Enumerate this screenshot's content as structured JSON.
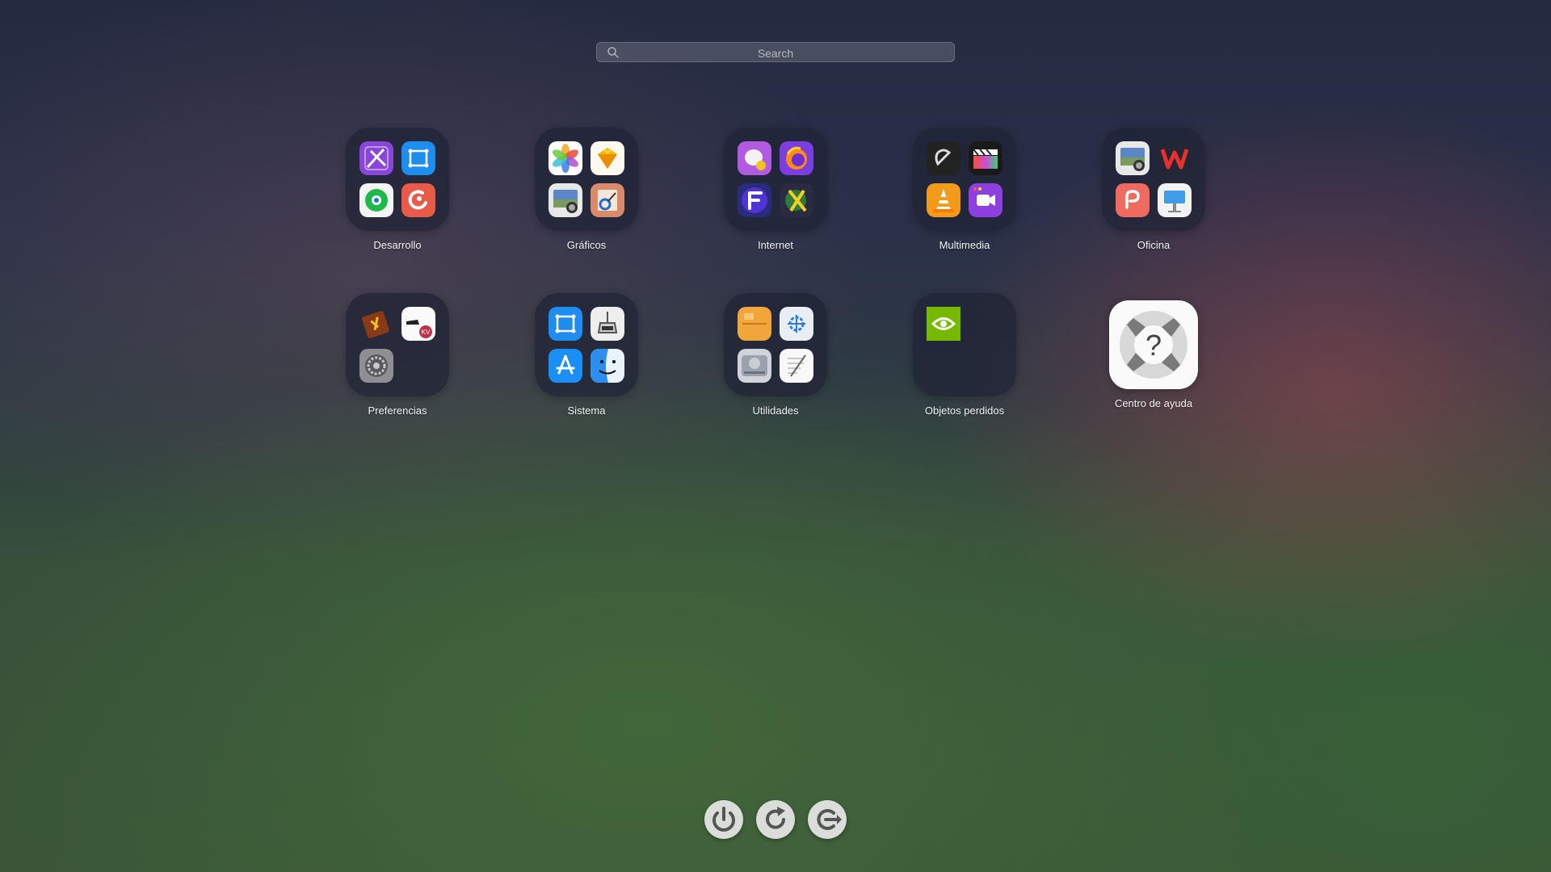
{
  "search": {
    "placeholder": "Search"
  },
  "folders": [
    {
      "label": "Desarrollo",
      "apps": [
        "xcode-tools-icon",
        "panel-app-icon",
        "green-circle-app-icon",
        "red-swirl-app-icon"
      ]
    },
    {
      "label": "Gráficos",
      "apps": [
        "photos-icon",
        "sketch-icon",
        "screenshot-icon",
        "preview-icon"
      ]
    },
    {
      "label": "Internet",
      "apps": [
        "messenger-bird-icon",
        "firefox-icon",
        "f-browser-icon",
        "globe-x-icon"
      ]
    },
    {
      "label": "Multimedia",
      "apps": [
        "obs-icon",
        "final-cut-icon",
        "vlc-icon",
        "screen-recorder-icon"
      ]
    },
    {
      "label": "Oficina",
      "apps": [
        "screenshot-icon",
        "wps-office-icon",
        "pdf-reader-icon",
        "keynote-icon"
      ]
    },
    {
      "label": "Preferencias",
      "apps": [
        "dictionary-icon",
        "kv-app-icon",
        "system-settings-icon"
      ]
    },
    {
      "label": "Sistema",
      "apps": [
        "panel-app-icon",
        "utility-icon",
        "app-store-icon",
        "finder-icon"
      ]
    },
    {
      "label": "Utilidades",
      "apps": [
        "archive-icon",
        "kde-icon",
        "disk-utility-icon",
        "textedit-icon"
      ]
    },
    {
      "label": "Objetos perdidos",
      "apps": [
        "nvidia-icon"
      ]
    }
  ],
  "help_app": {
    "label": "Centro de ayuda",
    "icon": "help-lifebuoy-icon"
  },
  "power_buttons": [
    "power-icon",
    "restart-icon",
    "logout-icon"
  ]
}
